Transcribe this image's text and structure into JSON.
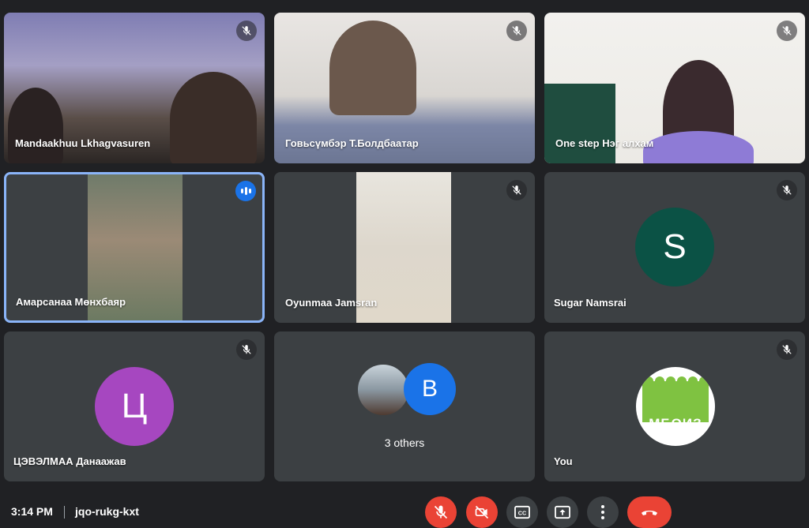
{
  "participants": [
    {
      "name": "Mandaakhuu Lkhagvasuren"
    },
    {
      "name": "Говьсүмбэр Т.Болдбаатар"
    },
    {
      "name": "One step Нэг алхам"
    },
    {
      "name": "Амарсанаа Мөнхбаяр"
    },
    {
      "name": "Oyunmaa Jamsran"
    },
    {
      "name": "Sugar Namsrai",
      "avatar_letter": "S",
      "avatar_color": "#0b5245"
    },
    {
      "name": "ЦЭВЭЛМАА Данаажав",
      "avatar_letter": "Ц",
      "avatar_color": "#a647c0"
    },
    {
      "name": "3 others",
      "avatar_letter": "B",
      "avatar_color": "#1a73e8"
    },
    {
      "name": "You",
      "logo_text": "МБОИЗ",
      "logo_color": "#7fc241"
    }
  ],
  "bottom_bar": {
    "time": "3:14 PM",
    "meeting_code": "jqo-rukg-kxt"
  },
  "controls": [
    {
      "icon": "mic-off-icon"
    },
    {
      "icon": "camera-off-icon"
    },
    {
      "icon": "captions-icon"
    },
    {
      "icon": "present-screen-icon"
    },
    {
      "icon": "more-options-icon"
    },
    {
      "icon": "leave-call-icon"
    }
  ],
  "colors": {
    "background": "#202124",
    "tile": "#3c4043",
    "danger": "#ea4335",
    "active_border": "#8ab4f8"
  }
}
